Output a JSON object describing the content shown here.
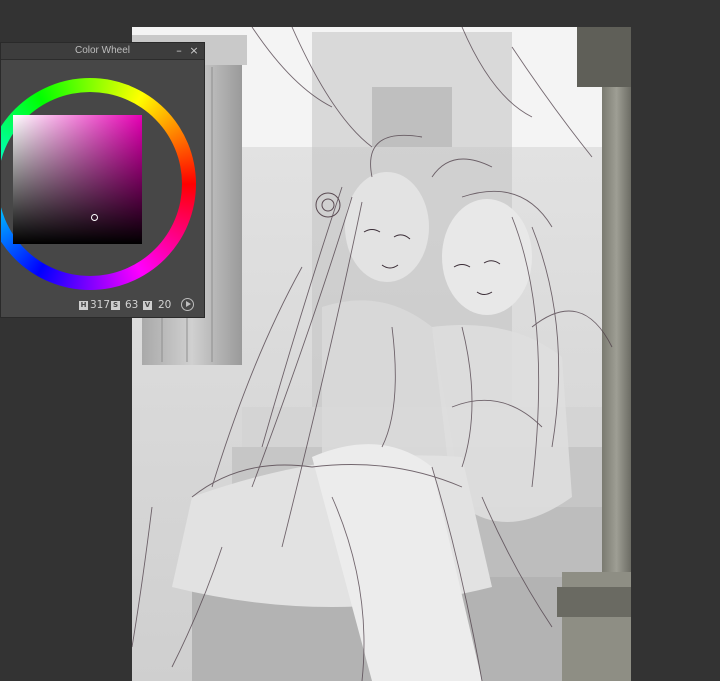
{
  "palette": {
    "title": "Color Wheel",
    "minimize_label": "–",
    "close_label": "×",
    "hue_label": "H",
    "hue_value": "317",
    "saturation_label": "S",
    "saturation_value": "63",
    "value_label": "V",
    "value_value": "20",
    "selected_hue_color": "#e600b4"
  },
  "canvas": {
    "background": "#dcdcdc",
    "artwork": "sketch-illustration"
  },
  "workspace": {
    "background": "#333333"
  }
}
